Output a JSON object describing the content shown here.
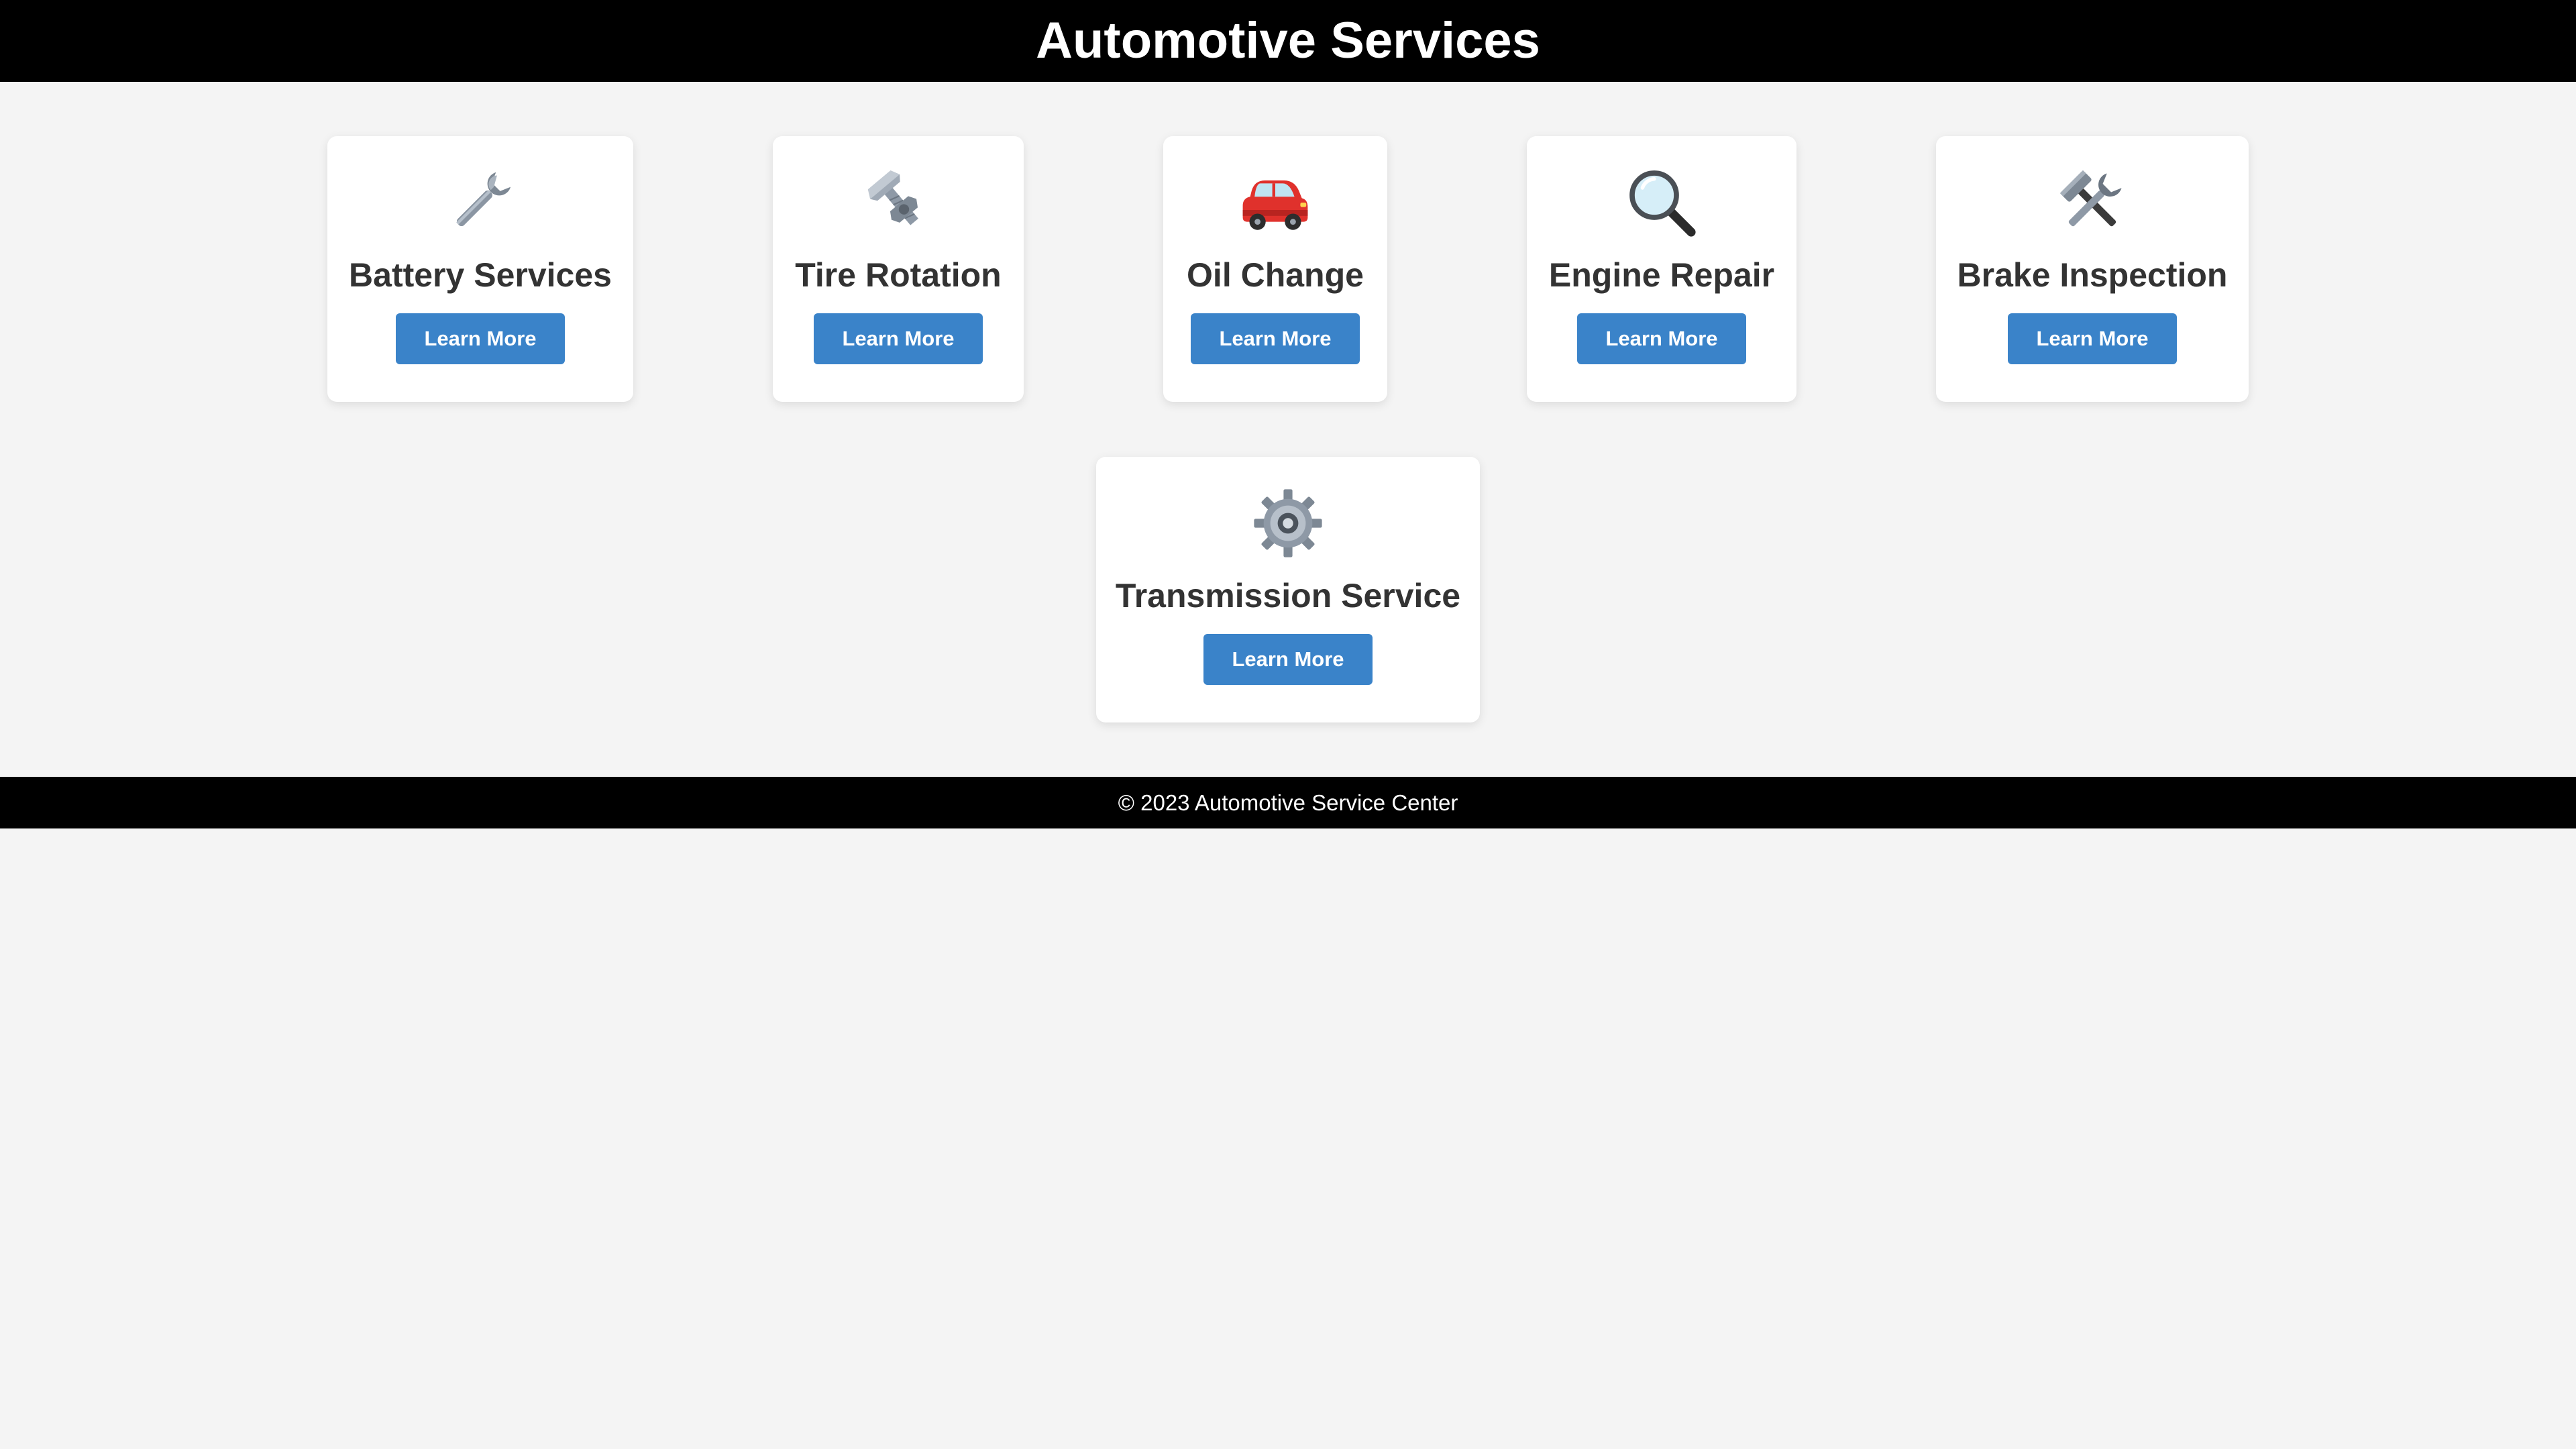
{
  "header": {
    "title": "Automotive Services"
  },
  "services": [
    {
      "title": "Battery Services",
      "icon": "wrench-icon",
      "button_label": "Learn More"
    },
    {
      "title": "Tire Rotation",
      "icon": "nut-and-bolt-icon",
      "button_label": "Learn More"
    },
    {
      "title": "Oil Change",
      "icon": "car-icon",
      "button_label": "Learn More"
    },
    {
      "title": "Engine Repair",
      "icon": "magnifying-glass-icon",
      "button_label": "Learn More"
    },
    {
      "title": "Brake Inspection",
      "icon": "hammer-and-wrench-icon",
      "button_label": "Learn More"
    },
    {
      "title": "Transmission Service",
      "icon": "gear-icon",
      "button_label": "Learn More"
    }
  ],
  "footer": {
    "text": "© 2023 Automotive Service Center"
  },
  "colors": {
    "header_bg": "#000000",
    "page_bg": "#f4f4f4",
    "button_bg": "#3a83c9",
    "title_text": "#333333"
  }
}
